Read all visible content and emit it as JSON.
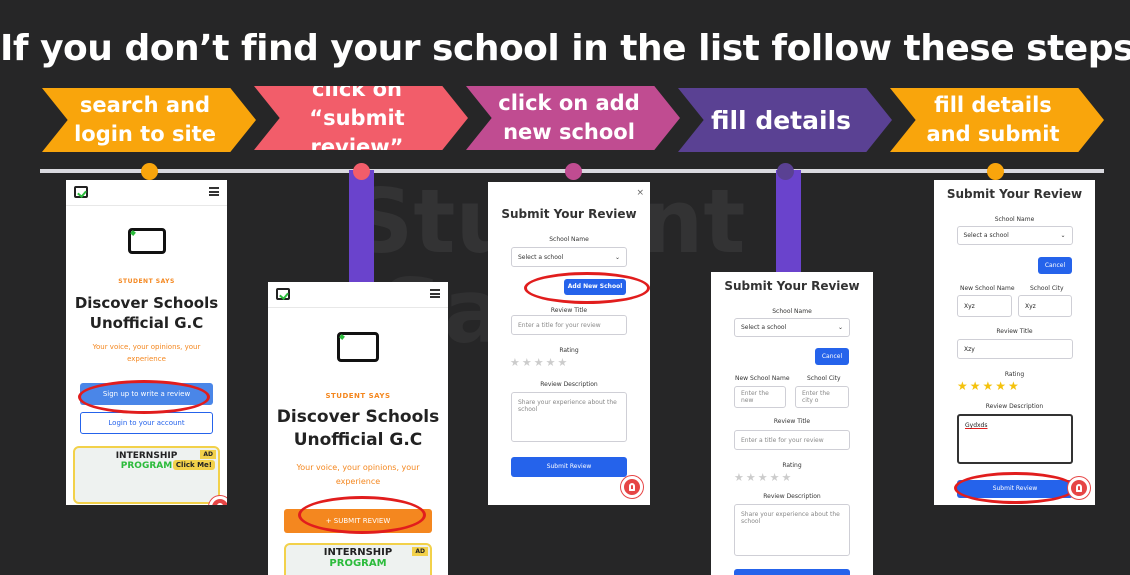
{
  "title": "If you don’t find your school in the list follow these steps:-",
  "colors": {
    "step1": "#f9a50c",
    "step2": "#f25d6a",
    "step3": "#c04c91",
    "step4": "#5a4193",
    "step5": "#f9a50c",
    "pillar": "#6a43cc",
    "submit": "#2563eb",
    "accent": "#f4871f"
  },
  "steps": [
    {
      "line1": "search and",
      "line2": "login to site"
    },
    {
      "line1": "click on “submit",
      "line2": "review”"
    },
    {
      "line1": "click on add",
      "line2": "new school"
    },
    {
      "line1": "fill details",
      "line2": ""
    },
    {
      "line1": "fill details",
      "line2": "and submit"
    }
  ],
  "home": {
    "student_says": "STUDENT SAYS",
    "discover_line1": "Discover Schools",
    "discover_line2": "Unofficial G.C",
    "voice_line1": "Your voice, your opinions, your",
    "voice_line2": "experience",
    "signup": "Sign up to write a review",
    "login": "Login to your account",
    "ad_tag": "AD",
    "ad_title": "INTERNSHIP",
    "ad_program": "PROGRAM",
    "click_me": "Click Me!",
    "submit_review": "+ SUBMIT REVIEW"
  },
  "form": {
    "title": "Submit Your Review",
    "school_name": "School Name",
    "select_school": "Select a school",
    "add_new_school": "Add New School",
    "cancel": "Cancel",
    "new_school_name": "New School Name",
    "school_city": "School City",
    "new_school_placeholder": "Enter the new",
    "city_placeholder": "Enter the city o",
    "review_title": "Review Title",
    "review_title_placeholder": "Enter a title for your review",
    "rating": "Rating",
    "review_description": "Review Description",
    "description_placeholder": "Share your experience about the school",
    "submit": "Submit Review",
    "close": "×",
    "filled_school": "Xyz",
    "filled_city": "Xyz",
    "filled_title": "Xzy",
    "filled_description": "Gydxds",
    "stars": "★★★★★"
  }
}
